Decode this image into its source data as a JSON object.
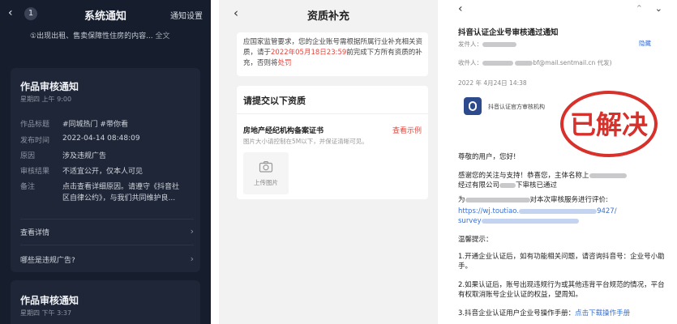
{
  "panel1": {
    "back_glyph": "‹",
    "badge": "1",
    "title": "系统通知",
    "settings": "通知设置",
    "top_note": "①出现出租、售卖保障性住房的内容... ",
    "top_note_more": "全文",
    "card1": {
      "title": "作品审核通知",
      "date": "星期四 上午 9:00",
      "rows": [
        {
          "k": "作品标题",
          "v": "#同城热门 #带你看"
        },
        {
          "k": "发布时间",
          "v": "2022-04-14 08:48:09"
        },
        {
          "k": "原因",
          "v": "涉及违规广告"
        },
        {
          "k": "审核结果",
          "v": "不适宜公开，仅本人可见"
        },
        {
          "k": "备注",
          "v": "点击查看详细原因。请遵守《抖音社"
        },
        {
          "k": "",
          "v": "区自律公约》，与我们共同维护良..."
        }
      ],
      "link1": "查看详情",
      "link2": "哪些是违规广告?"
    },
    "card2": {
      "title": "作品审核通知",
      "date": "星期四 下午 3:37"
    }
  },
  "panel2": {
    "back_glyph": "‹",
    "title": "资质补充",
    "notice_a": "应国家监管要求，您的企业账号需根据所属行业补充相关资质，请于",
    "notice_date": "2022年05月18日23:59",
    "notice_b": "前完成下方所有资质的补充，否则将",
    "notice_penalty": "处罚",
    "submit_heading": "请提交以下资质",
    "cert_label": "房地产经纪机构备案证书",
    "sample_link": "查看示例",
    "hint": "图片大小请控制在5M以下，并保证清晰可见。",
    "upload_label": "上传图片"
  },
  "panel3": {
    "back_glyph": "‹",
    "subject": "抖音认证企业号审核通过通知",
    "sender_label": "发件人：",
    "recipient_label": "收件人：",
    "recipient_suffix": "bf@mail.sentmail.cn 代发)",
    "date": "2022 年 4月24日 14:38",
    "hide": "隐藏",
    "org": "抖音认证官方审核机构",
    "stamp": "已解决",
    "greeting": "尊敬的用户，您好!",
    "p1a": "感谢您的关注与支持！恭喜您，主体名称上",
    "p1b": "经过有限公司",
    "p1c": "下审核已通过",
    "p2a": "为",
    "p2b": "对本次审核服务进行评价:",
    "url_a": "https://wj.toutiao.",
    "url_b": "9427/",
    "url_c": "survey",
    "tips_title": "温馨提示：",
    "tip1": "1.开通企业认证后，如有功能相关问题，请咨询抖音号：企业号小助手。",
    "tip2": "2.如果认证后，账号出现违规行为或其他违背平台规范的情况，平台有权取消账号企业认证的权益，望周知。",
    "tip3": "3.抖音企业认证用户企业号操作手册：",
    "tip3_link": "点击下载操作手册"
  }
}
